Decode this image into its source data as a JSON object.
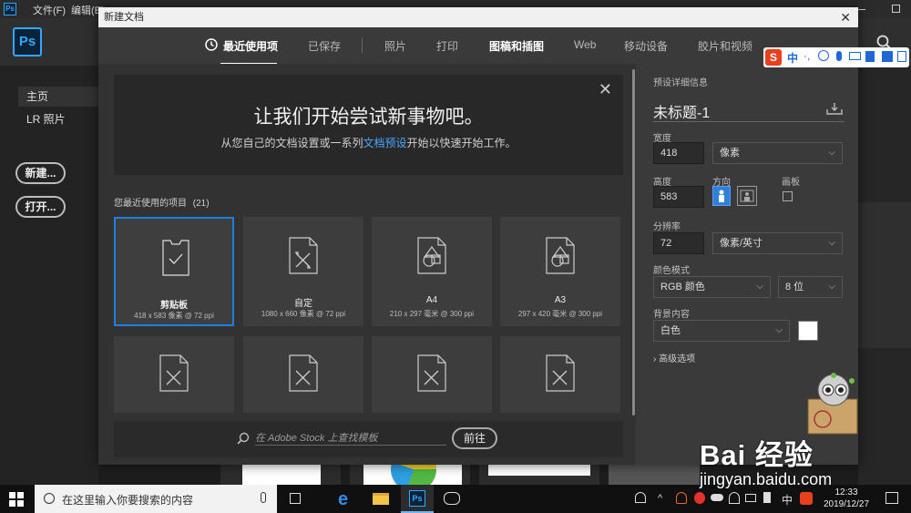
{
  "photoshop": {
    "menu": [
      "文件(F)",
      "编辑(E)"
    ],
    "side_nav": [
      {
        "label": "主页"
      },
      {
        "label": "LR 照片"
      }
    ],
    "new_button": "新建...",
    "open_button": "打开..."
  },
  "dialog": {
    "title": "新建文档",
    "tabs": [
      {
        "label": "最近使用项"
      },
      {
        "label": "已保存"
      },
      {
        "label": "照片"
      },
      {
        "label": "打印"
      },
      {
        "label": "图稿和插图"
      },
      {
        "label": "Web"
      },
      {
        "label": "移动设备"
      },
      {
        "label": "胶片和视频"
      }
    ],
    "welcome": {
      "title": "让我们开始尝试新事物吧。",
      "subtitle_pre": "从您自己的文档设置或一系列",
      "subtitle_link": "文档预设",
      "subtitle_post": "开始以快速开始工作。"
    },
    "recent_label": "您最近使用的项目",
    "recent_count": "(21)",
    "recent_items": [
      {
        "name": "剪贴板",
        "meta": "418 x 583 像素 @ 72 ppi"
      },
      {
        "name": "自定",
        "meta": "1080 x 660 像素 @ 72 ppi"
      },
      {
        "name": "A4",
        "meta": "210 x 297 毫米 @ 300 ppi"
      },
      {
        "name": "A3",
        "meta": "297 x 420 毫米 @ 300 ppi"
      }
    ],
    "stock_placeholder": "在 Adobe Stock 上查找模板",
    "stock_button": "前往",
    "preset": {
      "section": "预设详细信息",
      "doc_name": "未标题-1",
      "width_label": "宽度",
      "width": "418",
      "width_unit": "像素",
      "height_label": "高度",
      "height": "583",
      "orientation_label": "方向",
      "artboard_label": "画板",
      "resolution_label": "分辨率",
      "resolution": "72",
      "resolution_unit": "像素/英寸",
      "color_mode_label": "颜色模式",
      "color_mode": "RGB 颜色",
      "bit_depth": "8 位",
      "background_label": "背景内容",
      "background": "白色",
      "advanced": "高级选项"
    }
  },
  "taskbar": {
    "search_placeholder": "在这里输入你要搜索的内容",
    "time": "12:33",
    "date": "2019/12/27"
  },
  "ime": {
    "lang": "中"
  },
  "watermark": {
    "brand": "Bai 经验",
    "url": "jingyan.baidu.com"
  }
}
